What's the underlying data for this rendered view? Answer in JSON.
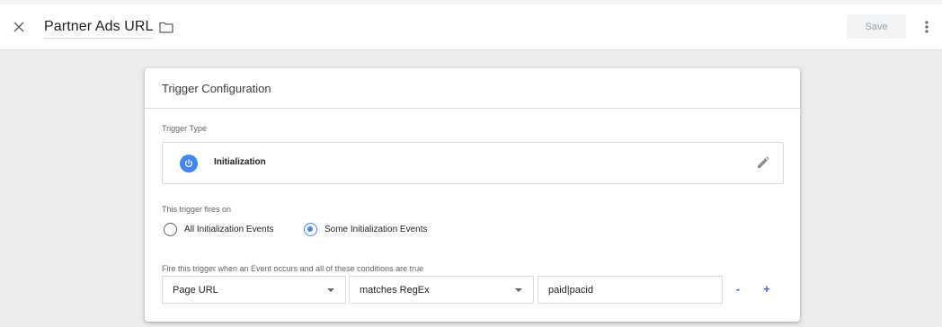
{
  "header": {
    "close_icon": "close-icon",
    "title": "Partner Ads URL",
    "folder_icon": "folder-icon",
    "save_label": "Save",
    "more_icon": "more-vert-icon"
  },
  "card": {
    "title": "Trigger Configuration",
    "trigger_type_label": "Trigger Type",
    "trigger_type": {
      "name": "Initialization",
      "icon": "power-icon",
      "icon_color": "#4285f4",
      "edit_icon": "pencil-icon"
    },
    "fires_on_label": "This trigger fires on",
    "fires_on_options": [
      {
        "label": "All Initialization Events",
        "selected": false
      },
      {
        "label": "Some Initialization Events",
        "selected": true
      }
    ],
    "condition_label": "Fire this trigger when an Event occurs and all of these conditions are true",
    "condition": {
      "variable": "Page URL",
      "operator": "matches RegEx",
      "value": "paid|pacid",
      "remove_label": "-",
      "add_label": "+"
    }
  },
  "colors": {
    "accent": "#1a73e8",
    "radio_selected": "#4285f4",
    "background": "#ececec"
  }
}
